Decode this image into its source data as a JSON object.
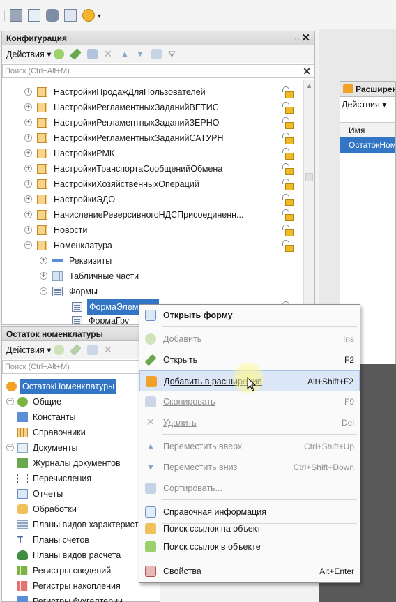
{
  "toolbar": {
    "icons": [
      "config-icon",
      "tree-icon",
      "database-icon",
      "window-icon",
      "play-icon"
    ]
  },
  "config_panel": {
    "title": "Конфигурация",
    "actions_label": "Действия ▾",
    "search_placeholder": "Поиск (Ctrl+Alt+M)",
    "rows": [
      {
        "label": "НастройкиПродажДляПользователей"
      },
      {
        "label": "НастройкиРегламентныхЗаданийВЕТИС"
      },
      {
        "label": "НастройкиРегламентныхЗаданийЗЕРНО"
      },
      {
        "label": "НастройкиРегламентныхЗаданийСАТУРН"
      },
      {
        "label": "НастройкиРМК"
      },
      {
        "label": "НастройкиТранспортаСообщенийОбмена"
      },
      {
        "label": "НастройкиХозяйственныхОпераций"
      },
      {
        "label": "НастройкиЭДО"
      },
      {
        "label": "НачислениеРеверсивногоНДСПрисоединенн..."
      },
      {
        "label": "Новости"
      },
      {
        "label": "Номенклатура"
      }
    ],
    "children": {
      "attributes": "Реквизиты",
      "tabular": "Табличные части",
      "forms": "Формы",
      "form_element": "ФормаЭлемента",
      "form_group": "ФормаГру"
    }
  },
  "ext_panel": {
    "title": "Остаток номенклатуры",
    "actions_label": "Действия ▾",
    "search_placeholder": "Поиск (Ctrl+Alt+M)",
    "root": "ОстатокНоменклатуры",
    "items": [
      {
        "label": "Общие"
      },
      {
        "label": "Константы"
      },
      {
        "label": "Справочники"
      },
      {
        "label": "Документы"
      },
      {
        "label": "Журналы документов"
      },
      {
        "label": "Перечисления"
      },
      {
        "label": "Отчеты"
      },
      {
        "label": "Обработки"
      },
      {
        "label": "Планы видов характеристик"
      },
      {
        "label": "Планы счетов"
      },
      {
        "label": "Планы видов расчета"
      },
      {
        "label": "Регистры сведений"
      },
      {
        "label": "Регистры накопления"
      },
      {
        "label": "Регистры бухгалтерии"
      }
    ]
  },
  "right_window": {
    "title": "Расширения",
    "actions_label": "Действия ▾",
    "col_name": "Имя",
    "row": "ОстатокНоменклатуры"
  },
  "context_menu": {
    "items": [
      {
        "label": "Открыть форму",
        "key": "",
        "bold": true,
        "disabled": false
      },
      {
        "label": "Добавить",
        "key": "Ins",
        "bold": false,
        "disabled": true
      },
      {
        "label": "Открыть",
        "key": "F2",
        "bold": false,
        "disabled": false
      },
      {
        "label": "Добавить в расширение",
        "key": "Alt+Shift+F2",
        "bold": false,
        "disabled": false,
        "hover": true
      },
      {
        "label": "Скопировать",
        "key": "F9",
        "bold": false,
        "disabled": true
      },
      {
        "label": "Удалить",
        "key": "Del",
        "bold": false,
        "disabled": true
      },
      {
        "label": "Переместить вверх",
        "key": "Ctrl+Shift+Up",
        "bold": false,
        "disabled": true
      },
      {
        "label": "Переместить вниз",
        "key": "Ctrl+Shift+Down",
        "bold": false,
        "disabled": true
      },
      {
        "label": "Сортировать...",
        "key": "",
        "bold": false,
        "disabled": true
      },
      {
        "label": "Справочная информация",
        "key": "",
        "bold": false,
        "disabled": false
      },
      {
        "label": "Поиск ссылок на объект",
        "key": "",
        "bold": false,
        "disabled": false
      },
      {
        "label": "Поиск ссылок в объекте",
        "key": "",
        "bold": false,
        "disabled": false
      },
      {
        "label": "Свойства",
        "key": "Alt+Enter",
        "bold": false,
        "disabled": false
      }
    ]
  },
  "colors": {
    "selection": "#3376c6",
    "menu_hover": "#dbe7f6"
  }
}
